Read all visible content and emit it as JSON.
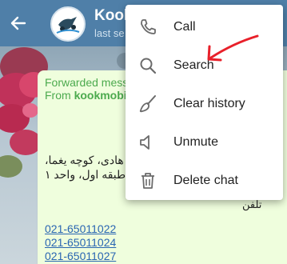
{
  "header": {
    "title": "Kook",
    "status": "last se"
  },
  "bubble": {
    "forward_label": "Forwarded mess",
    "forward_from_prefix": "From",
    "forward_from_name": "kookmobil",
    "address_line1": "هادی، کوچه یغما،",
    "address_line2": "طبقه اول، واحد ۱",
    "tel_label": "تلفن",
    "phones": [
      "021-65011022",
      "021-65011024",
      "021-65011027"
    ]
  },
  "menu": {
    "items": [
      {
        "label": "Call",
        "icon": "phone-icon"
      },
      {
        "label": "Search",
        "icon": "search-icon"
      },
      {
        "label": "Clear history",
        "icon": "broom-icon"
      },
      {
        "label": "Unmute",
        "icon": "speaker-icon"
      },
      {
        "label": "Delete chat",
        "icon": "trash-icon"
      }
    ]
  },
  "colors": {
    "header": "#4f7fa8",
    "bubble": "#effedd",
    "forward_text": "#4caa4e",
    "link": "#2a66b2",
    "annotation_arrow": "#e8202a"
  }
}
